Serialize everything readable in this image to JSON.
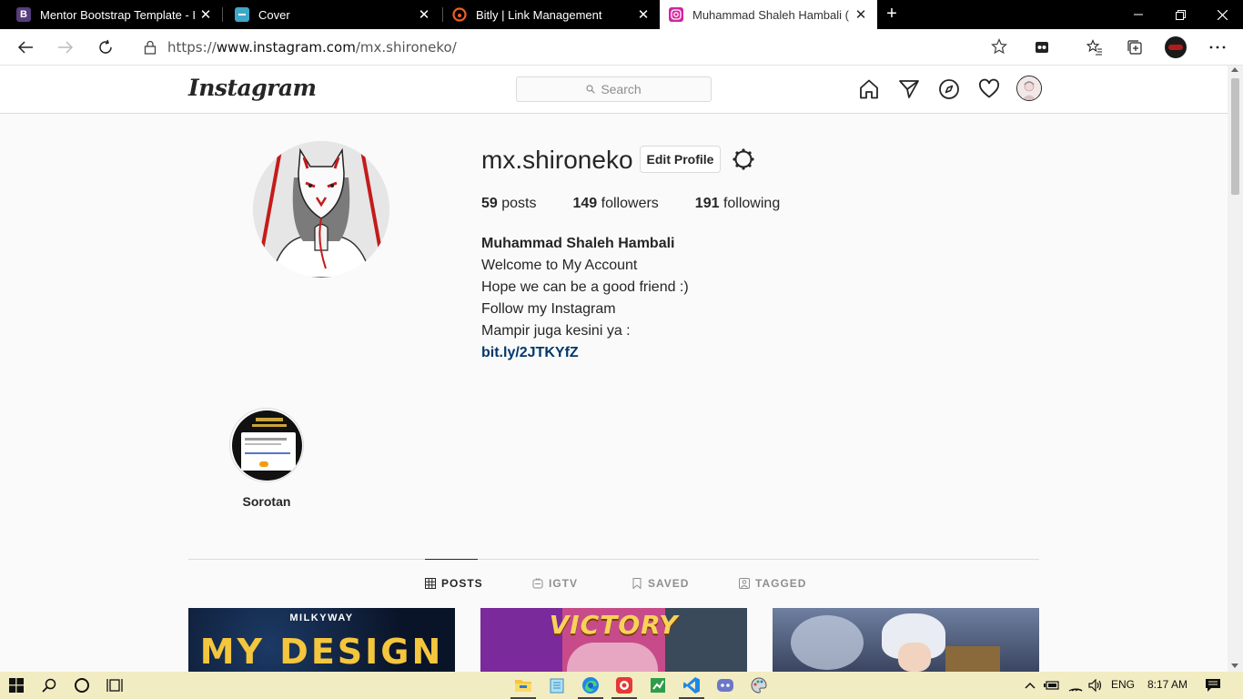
{
  "browser": {
    "tabs": [
      {
        "title": "Mentor Bootstrap Template - Index",
        "favicon": "B"
      },
      {
        "title": "Cover",
        "favicon": ""
      },
      {
        "title": "Bitly | Link Management",
        "favicon": ""
      },
      {
        "title": "Muhammad Shaleh Hambali (@mx.shironeko)",
        "favicon": ""
      }
    ],
    "url_prefix": "https://",
    "url_domain": "www.instagram.com",
    "url_path": "/mx.shironeko/"
  },
  "instagram": {
    "logo": "Instagram",
    "search_placeholder": "Search",
    "profile": {
      "username": "mx.shironeko",
      "edit_label": "Edit Profile",
      "posts_count": "59",
      "posts_label": "posts",
      "followers_count": "149",
      "followers_label": "followers",
      "following_count": "191",
      "following_label": "following",
      "full_name": "Muhammad Shaleh Hambali",
      "bio_lines": [
        "Welcome to My Account",
        "Hope we can be a good friend :)",
        "Follow my Instagram",
        "Mampir juga kesini ya :"
      ],
      "link": "bit.ly/2JTKYfZ"
    },
    "highlight": {
      "label": "Sorotan"
    },
    "tabs": [
      {
        "label": "POSTS",
        "active": true
      },
      {
        "label": "IGTV",
        "active": false
      },
      {
        "label": "SAVED",
        "active": false
      },
      {
        "label": "TAGGED",
        "active": false
      }
    ],
    "posts": [
      {
        "top_text": "MILKYWAY",
        "main_text": "MY DESIGN"
      },
      {
        "main_text": "VICTORY"
      },
      {
        "main_text": ""
      }
    ]
  },
  "taskbar": {
    "language": "ENG",
    "time": "8:17 AM"
  },
  "colors": {
    "link": "#00376b",
    "taskbar": "#f2ecc3",
    "tab_strip": "#000000"
  }
}
